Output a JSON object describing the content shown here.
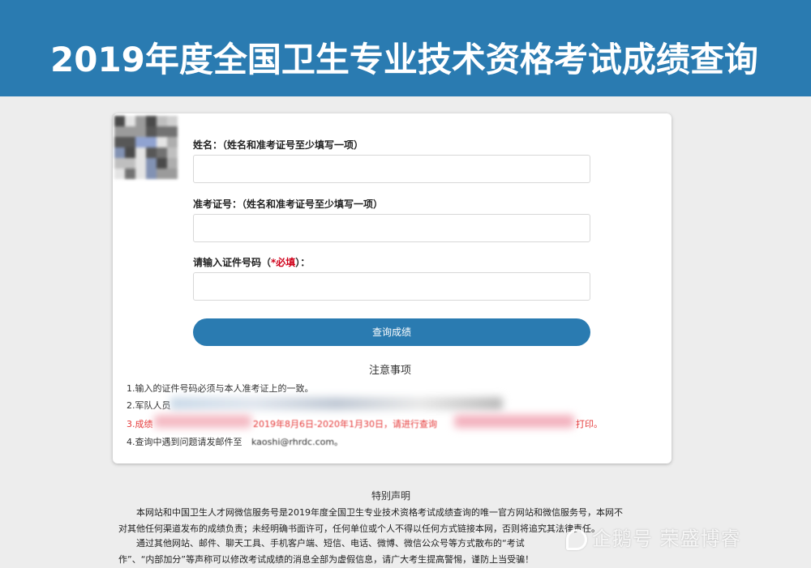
{
  "header": {
    "title": "2019年度全国卫生专业技术资格考试成绩查询",
    "background": "#2a7bb1"
  },
  "form": {
    "name_label": "姓名：（姓名和准考证号至少填写一项）",
    "exam_no_label": "准考证号：（姓名和准考证号至少填写一项）",
    "id_label_prefix": "请输入证件号码（",
    "id_label_required": "*必填",
    "id_label_suffix": "）：",
    "name_value": "",
    "exam_no_value": "",
    "id_value": "",
    "submit_label": "查询成绩"
  },
  "notice": {
    "title": "注意事项",
    "items": [
      "1.输入的证件号码必须与本人准考证上的一致。",
      "2.军队人员",
      "3.成绩",
      "4.查询中遇到问题请发邮件至"
    ],
    "item3_visible_fragment": "2019年8月6日-2020年1月30日，请进行查询",
    "item3_tail": "打印。",
    "item4_tail": "kaoshi@rhrdc.com。"
  },
  "declaration": {
    "title": "特别声明",
    "paragraph1_line1": "本网站和中国卫生人才网微信服务号是2019年度全国卫生专业技术资格考试成绩查询的唯一官方网站和微信服务号，本网不",
    "paragraph1_line2": "对其他任何渠道发布的成绩负责；未经明确书面许可，任何单位或个人不得以任何方式链接本网，否则将追究其法律责任。",
    "paragraph2_line1": "通过其他网站、邮件、聊天工具、手机客户端、短信、电话、微博、微信公众号等方式散布的“考试",
    "paragraph2_line2": "作”、“内部加分”等声称可以修改考试成绩的消息全部为虚假信息，请广大考生提高警惕，谨防上当受骗！"
  },
  "watermark": {
    "text": "企鹅号 荣盛博睿"
  }
}
